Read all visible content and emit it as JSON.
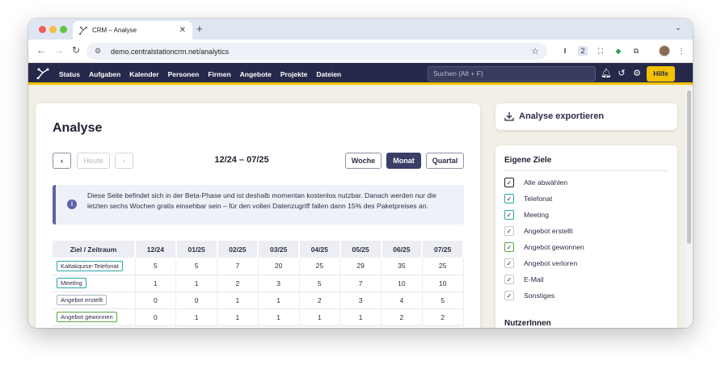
{
  "browser": {
    "tab_title": "CRM – Analyse",
    "new_tab": "+",
    "url": "demo.centralstationcrm.net/analytics",
    "ext_badge": "2"
  },
  "nav": {
    "items": [
      "Status",
      "Aufgaben",
      "Kalender",
      "Personen",
      "Firmen",
      "Angebote",
      "Projekte",
      "Dateien"
    ],
    "search_placeholder": "Suchen (Alt + F)",
    "help_label": "Hilfe"
  },
  "main": {
    "title": "Analyse",
    "prev_label": "‹",
    "today_label": "Heute",
    "next_label": "›",
    "range_label": "12/24 – 07/25",
    "period_buttons": [
      "Woche",
      "Monat",
      "Quartal"
    ],
    "active_period": "Monat",
    "info_text": "Diese Seite befindet sich in der Beta-Phase und ist deshalb momentan kostenlos nutzbar. Danach werden nur die letzten sechs Wochen gratis einsehbar sein – für den vollen Datenzugriff fallen dann 15% des Paketpreises an.",
    "table": {
      "headers": [
        "Ziel / Zeitraum",
        "12/24",
        "01/25",
        "02/25",
        "03/25",
        "04/25",
        "05/25",
        "06/25",
        "07/25"
      ],
      "rows": [
        {
          "label": "Kaltakquise-Telefonat",
          "color": "#2aa6a6",
          "values": [
            "5",
            "5",
            "7",
            "20",
            "25",
            "29",
            "35",
            "25"
          ]
        },
        {
          "label": "Meeting",
          "color": "#2aa6a6",
          "values": [
            "1",
            "1",
            "2",
            "3",
            "5",
            "7",
            "10",
            "10"
          ]
        },
        {
          "label": "Angebot erstellt",
          "color": "#b0b3c2",
          "values": [
            "0",
            "0",
            "1",
            "1",
            "2",
            "3",
            "4",
            "5"
          ]
        },
        {
          "label": "Angebot gewonnen",
          "color": "#5aa83c",
          "values": [
            "0",
            "1",
            "1",
            "1",
            "1",
            "1",
            "2",
            "2"
          ]
        }
      ]
    }
  },
  "side": {
    "export_label": "Analyse exportieren",
    "goals_title": "Eigene Ziele",
    "goals": [
      {
        "label": "Alle abwählen",
        "color": "#1f2030",
        "check": "✓"
      },
      {
        "label": "Telefonat",
        "color": "#2aa6a6",
        "check": "✓"
      },
      {
        "label": "Meeting",
        "color": "#2aa6a6",
        "check": "✓"
      },
      {
        "label": "Angebot erstellt",
        "color": "#c5c7d2",
        "check": "✓"
      },
      {
        "label": "Angebot gewonnen",
        "color": "#5aa83c",
        "check": "✓"
      },
      {
        "label": "Angebot verloren",
        "color": "#c5c7d2",
        "check": "✓"
      },
      {
        "label": "E-Mail",
        "color": "#c5c7d2",
        "check": "✓"
      },
      {
        "label": "Sonstiges",
        "color": "#c5c7d2",
        "check": "✓"
      }
    ],
    "users_title": "NutzerInnen"
  }
}
